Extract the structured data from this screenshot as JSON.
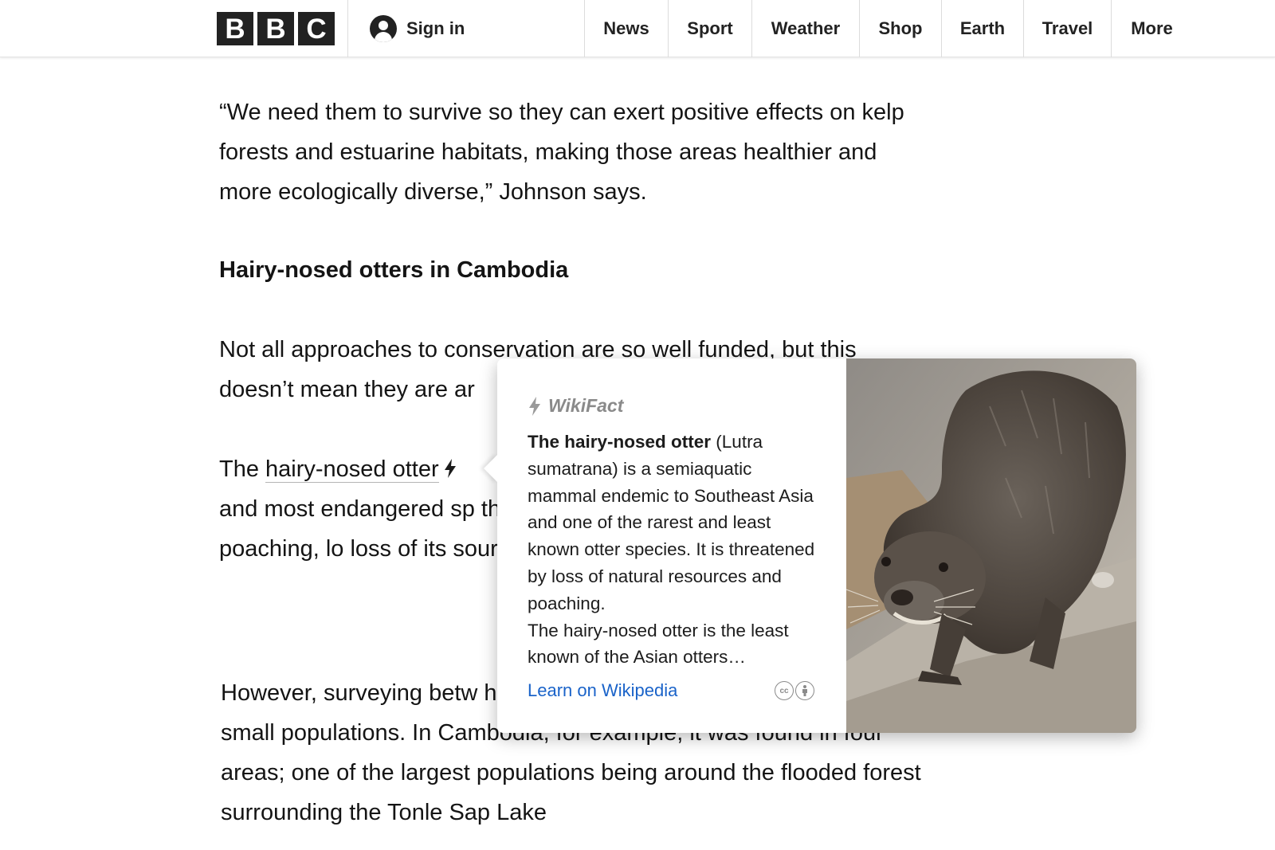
{
  "nav": {
    "logo_letters": [
      "B",
      "B",
      "C"
    ],
    "signin_label": "Sign in",
    "links": [
      "News",
      "Sport",
      "Weather",
      "Shop",
      "Earth",
      "Travel",
      "More"
    ]
  },
  "article": {
    "p1": "“We need them to survive so they can exert positive effects on kelp forests and estuarine habitats, making those areas healthier and more ecologically diverse,” Johnson says.",
    "heading": "Hairy-nosed otters in Cambodia",
    "p2": "Not all approaches to conservation are so well funded, but this doesn’t mean they are ar",
    "p3_prefix": "The ",
    "p3_link": "hairy-nosed otter",
    "p3_rest": "and most endangered sp thought extinct throughou habitat loss, poaching, lo loss of its sources of food",
    "p4": "However, surveying betw habitats confirmed the presence of several small populations. In Cambodia, for example, it was found in four areas; one of the largest populations being around the flooded forest surrounding the Tonle Sap Lake"
  },
  "wikifact": {
    "title": "WikiFact",
    "lead_bold": "The hairy-nosed otter",
    "body": " (Lutra sumatrana) is a semiaquatic mammal endemic to Southeast Asia and one of the rarest and least known otter species. It is threatened by loss of natural resources and poaching.",
    "body2": "The hairy-nosed otter is the least known of the Asian otters…",
    "learn_link": "Learn on Wikipedia",
    "license_icons": [
      "cc-icon",
      "attribution-icon"
    ]
  }
}
